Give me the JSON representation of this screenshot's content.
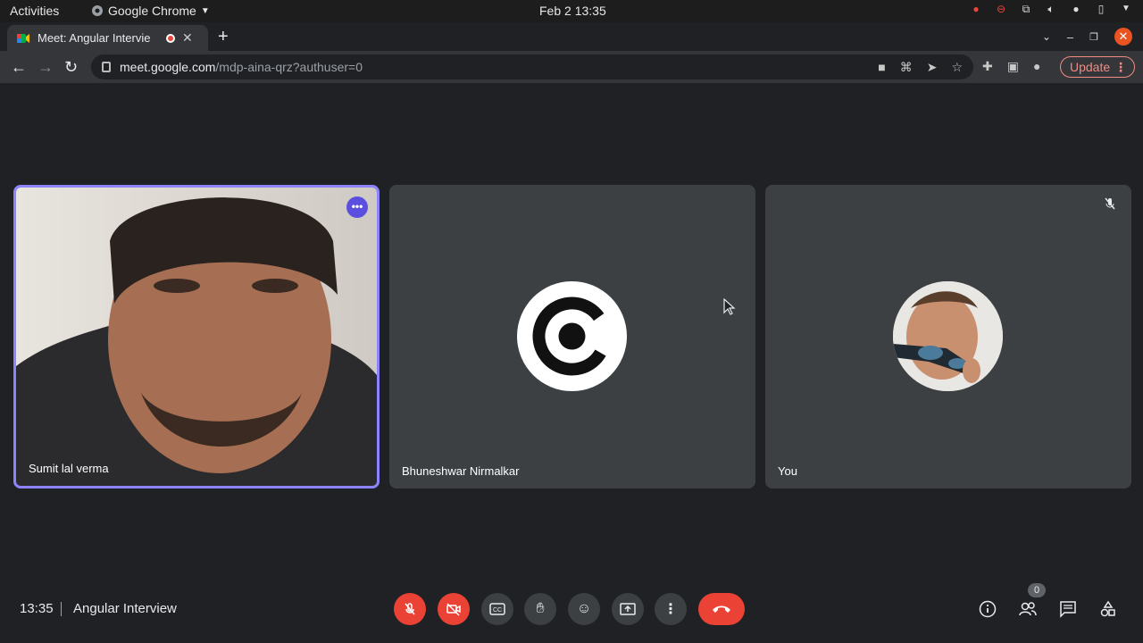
{
  "os_bar": {
    "activities": "Activities",
    "app_name": "Google Chrome",
    "datetime": "Feb 2  13:35"
  },
  "browser": {
    "tab_title": "Meet: Angular Intervie",
    "url_host": "meet.google.com",
    "url_path": "/mdp-aina-qrz?authuser=0",
    "update_label": "Update"
  },
  "participants": [
    {
      "name": "Sumit lal verma"
    },
    {
      "name": "Bhuneshwar Nirmalkar"
    },
    {
      "name": "You"
    }
  ],
  "meeting": {
    "time": "13:35",
    "title": "Angular Interview",
    "people_count": "0"
  },
  "colors": {
    "accent_red": "#ea4335",
    "active_border": "#8e83ff",
    "tile_bg": "#3c4043",
    "stage_bg": "#202124"
  }
}
